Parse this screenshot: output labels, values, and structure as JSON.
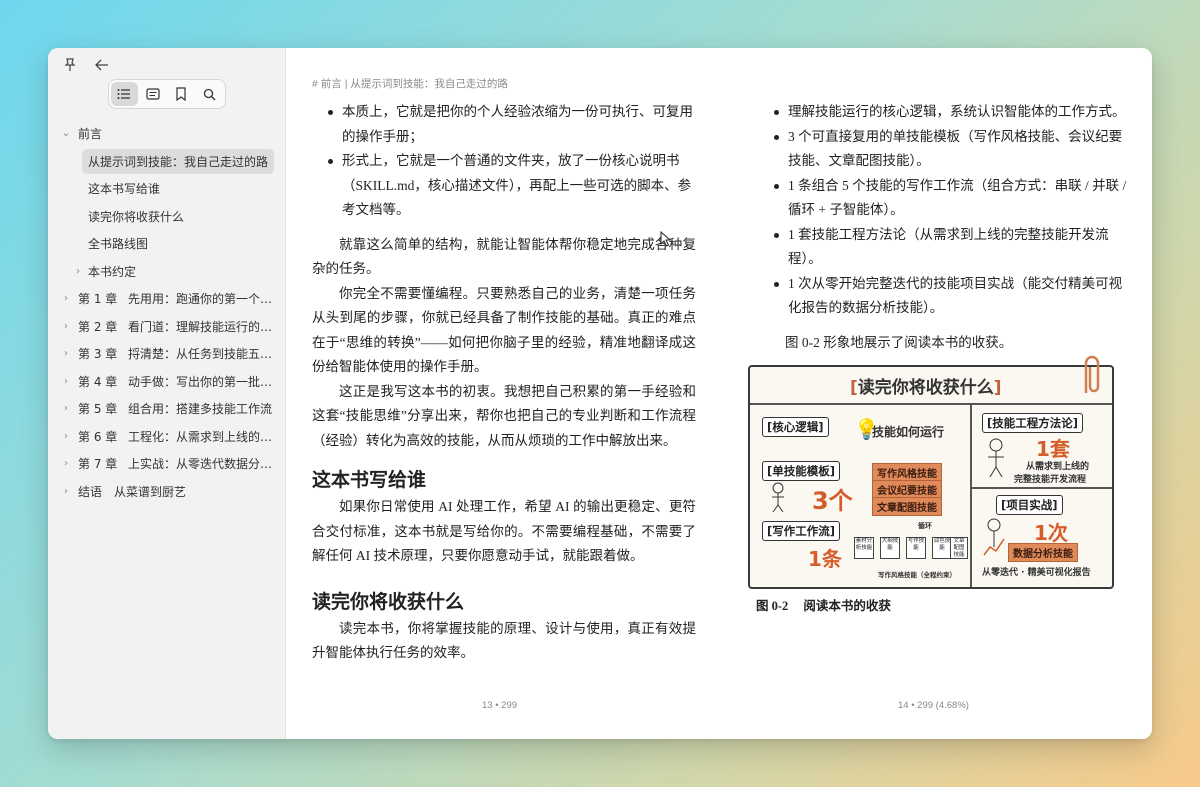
{
  "sidebar": {
    "tabs": [
      {
        "name": "toc",
        "icon": "list-icon"
      },
      {
        "name": "notes",
        "icon": "note-icon"
      },
      {
        "name": "bookmarks",
        "icon": "bookmark-icon"
      },
      {
        "name": "search",
        "icon": "search-icon"
      }
    ],
    "toc": {
      "preface": "前言",
      "preface_items": [
        "从提示词到技能：我自己走过的路",
        "这本书写给谁",
        "读完你将收获什么",
        "全书路线图"
      ],
      "conventions": "本书约定",
      "chapters": [
        {
          "num": "第 1 章",
          "title": "先用用：跑通你的第一个…"
        },
        {
          "num": "第 2 章",
          "title": "看门道：理解技能运行的…"
        },
        {
          "num": "第 3 章",
          "title": "捋清楚：从任务到技能五…"
        },
        {
          "num": "第 4 章",
          "title": "动手做：写出你的第一批…"
        },
        {
          "num": "第 5 章",
          "title": "组合用：搭建多技能工作流"
        },
        {
          "num": "第 6 章",
          "title": "工程化：从需求到上线的…"
        },
        {
          "num": "第 7 章",
          "title": "上实战：从零迭代数据分…"
        }
      ],
      "ending": {
        "num": "结语",
        "title": "从菜谱到厨艺"
      }
    }
  },
  "breadcrumb": {
    "hash": "#",
    "section": "前言",
    "separator": "|",
    "current": "从提示词到技能：我自己走过的路"
  },
  "left_page": {
    "bullet1": "本质上，它就是把你的个人经验浓缩为一份可执行、可复用的操作手册；",
    "bullet2": "形式上，它就是一个普通的文件夹，放了一份核心说明书（SKILL.md，核心描述文件），再配上一些可选的脚本、参考文档等。",
    "p1": "就靠这么简单的结构，就能让智能体帮你稳定地完成各种复杂的任务。",
    "p2": "你完全不需要懂编程。只要熟悉自己的业务，清楚一项任务从头到尾的步骤，你就已经具备了制作技能的基础。真正的难点在于“思维的转换”——如何把你脑子里的经验，精准地翻译成这份给智能体使用的操作手册。",
    "p3": "这正是我写这本书的初衷。我想把自己积累的第一手经验和这套“技能思维”分享出来，帮你也把自己的专业判断和工作流程（经验）转化为高效的技能，从而从烦琐的工作中解放出来。",
    "h_who": "这本书写给谁",
    "p_who": "如果你日常使用 AI 处理工作，希望 AI 的输出更稳定、更符合交付标准，这本书就是写给你的。不需要编程基础，不需要了解任何 AI 技术原理，只要你愿意动手试，就能跟着做。",
    "h_gain": "读完你将收获什么",
    "p_gain": "读完本书，你将掌握技能的原理、设计与使用，真正有效提升智能体执行任务的效率。",
    "footer": "13 • 299"
  },
  "right_page": {
    "bullets": [
      "理解技能运行的核心逻辑，系统认识智能体的工作方式。",
      "3 个可直接复用的单技能模板（写作风格技能、会议纪要技能、文章配图技能）。",
      "1 条组合 5 个技能的写作工作流（组合方式：串联 / 并联 / 循环 + 子智能体）。",
      "1 套技能工程方法论（从需求到上线的完整技能开发流程）。",
      "1 次从零开始完整迭代的技能项目实战（能交付精美可视化报告的数据分析技能）。"
    ],
    "fig_ref": "图 0-2 形象地展示了阅读本书的收获。",
    "figure": {
      "title": "读完你将收获什么",
      "core_logic": "[核心逻辑]",
      "how_skills_run": "技能如何运行",
      "single_templates": "[单技能模板]",
      "three": "3个",
      "t1": "写作风格技能",
      "t2": "会议纪要技能",
      "t3": "文章配图技能",
      "workflow": "[写作工作流]",
      "one_line": "1条",
      "loop": "循环",
      "flow_boxes": [
        "素材分析技能",
        "大纲技能",
        "写作技能",
        "润色技能",
        "文章配图技能"
      ],
      "flow_caption": "写作风格技能（全程约束）",
      "method": "[技能工程方法论]",
      "one_set": "1套",
      "method_desc1": "从需求到上线的",
      "method_desc2": "完整技能开发流程",
      "project": "[项目实战]",
      "one_time": "1次",
      "data_skill": "数据分析技能",
      "project_desc": "从零迭代 · 精美可视化报告"
    },
    "caption_num": "图 0-2",
    "caption_text": "阅读本书的收获",
    "footer": "14 • 299 (4.68%)"
  },
  "colors": {
    "accent": "#e08a5a",
    "number": "#d45d2a",
    "active_bg": "#dcdcdc"
  }
}
